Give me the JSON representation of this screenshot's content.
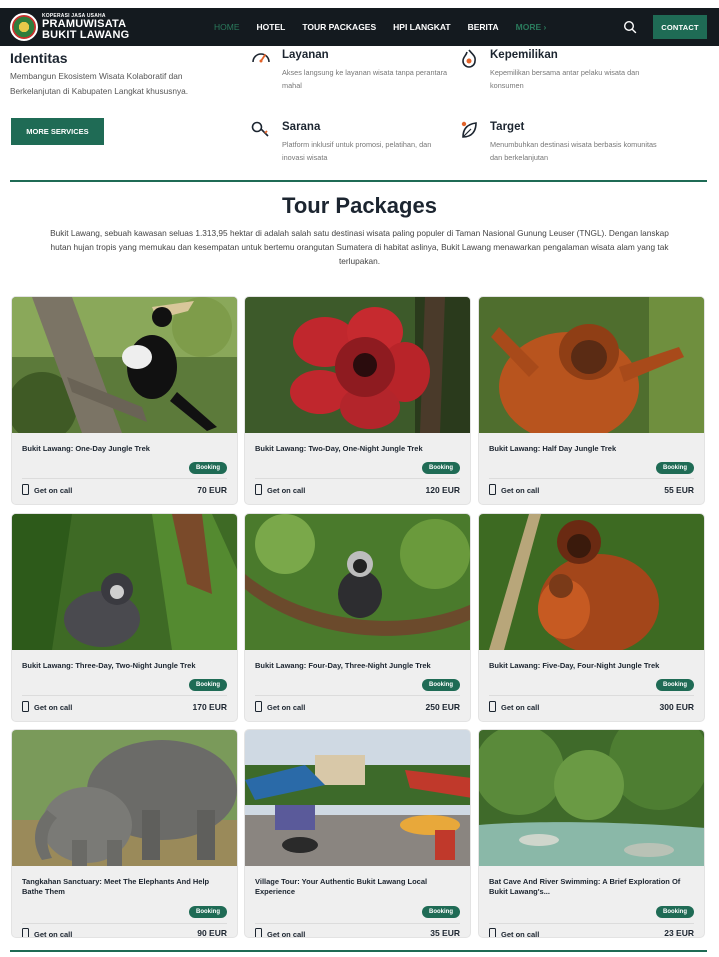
{
  "header": {
    "logo_small": "KOPERASI JASA USAHA",
    "logo_line1": "PRAMUWISATA",
    "logo_line2": "BUKIT LAWANG",
    "nav": [
      "HOME",
      "HOTEL",
      "TOUR PACKAGES",
      "HPI LANGKAT",
      "BERITA",
      "MORE ›"
    ],
    "contact_label": "CONTACT",
    "accent_color": "#1f6b55"
  },
  "features": {
    "identitas": {
      "title": "Identitas",
      "desc": "Membangun Ekosistem Wisata Kolaboratif dan Berkelanjutan di Kabupaten Langkat khususnya."
    },
    "more_services_label": "MORE SERVICES",
    "items": [
      {
        "icon": "gauge-icon",
        "title": "Layanan",
        "desc": "Akses langsung ke layanan wisata tanpa perantara mahal"
      },
      {
        "icon": "flame-icon",
        "title": "Kepemilikan",
        "desc": "Kepemilikan bersama antar pelaku wisata dan konsumen"
      },
      {
        "icon": "key-icon",
        "title": "Sarana",
        "desc": "Platform inklusif untuk promosi, pelatihan, dan inovasi wisata"
      },
      {
        "icon": "leaf-icon",
        "title": "Target",
        "desc": "Menumbuhkan destinasi wisata berbasis komunitas dan berkelanjutan"
      }
    ]
  },
  "tour_packages": {
    "title": "Tour Packages",
    "description": "Bukit Lawang, sebuah kawasan seluas 1.313,95 hektar di adalah salah satu destinasi wisata paling populer di Taman Nasional Gunung Leuser (TNGL). Dengan lanskap hutan hujan tropis yang memukau dan kesempatan untuk bertemu orangutan Sumatera di habitat aslinya, Bukit Lawang menawarkan pengalaman wisata alam yang tak terlupakan.",
    "badge_label": "Booking",
    "call_label": "Get on call",
    "cards": [
      {
        "title": "Bukit Lawang: One-Day Jungle Trek",
        "price": "70 EUR",
        "image": "hornbill-photo"
      },
      {
        "title": "Bukit Lawang: Two-Day, One-Night Jungle Trek",
        "price": "120 EUR",
        "image": "rafflesia-photo"
      },
      {
        "title": "Bukit Lawang: Half Day Jungle Trek",
        "price": "55 EUR",
        "image": "orangutan-photo"
      },
      {
        "title": "Bukit Lawang: Three-Day, Two-Night Jungle Trek",
        "price": "170 EUR",
        "image": "langur-photo"
      },
      {
        "title": "Bukit Lawang: Four-Day, Three-Night Jungle Trek",
        "price": "250 EUR",
        "image": "thomas-leaf-monkey-photo"
      },
      {
        "title": "Bukit Lawang: Five-Day, Four-Night Jungle Trek",
        "price": "300 EUR",
        "image": "orangutan-mother-baby-photo"
      },
      {
        "title": "Tangkahan Sanctuary: Meet The Elephants And Help Bathe Them",
        "price": "90 EUR",
        "image": "elephants-photo"
      },
      {
        "title": "Village Tour: Your Authentic Bukit Lawang Local Experience",
        "price": "35 EUR",
        "image": "village-market-photo"
      },
      {
        "title": "Bat Cave And River Swimming: A Brief Exploration Of Bukit Lawang's...",
        "price": "23 EUR",
        "image": "river-photo"
      }
    ]
  }
}
